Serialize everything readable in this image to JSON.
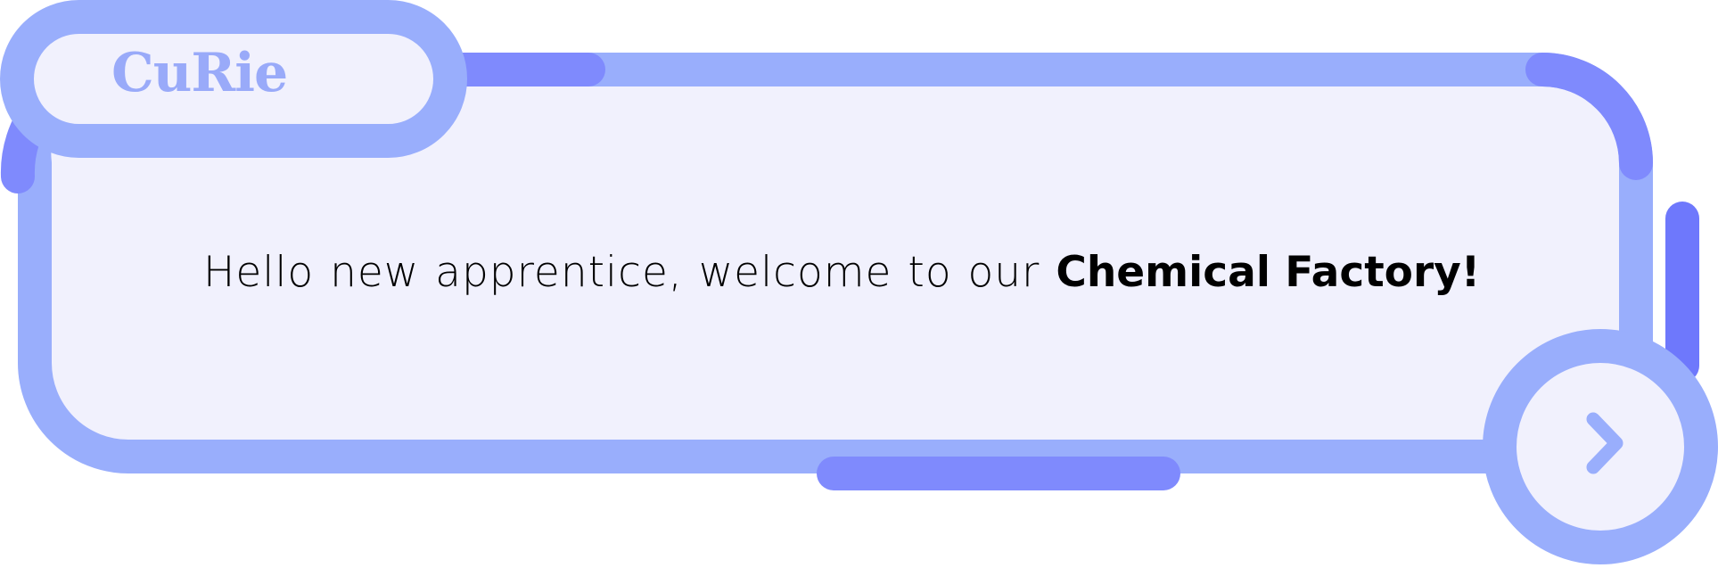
{
  "dialog": {
    "title": "CuRie",
    "message": {
      "regular": "Hello new apprentice, welcome to our ",
      "bold": "Chemical Factory!"
    }
  },
  "controls": {
    "next_icon": "chevron-right-icon"
  },
  "colors": {
    "frame": "#99aefc",
    "frame_accent": "#7f8afd",
    "panel_fill": "#f1f1fd",
    "text": "#000000"
  }
}
